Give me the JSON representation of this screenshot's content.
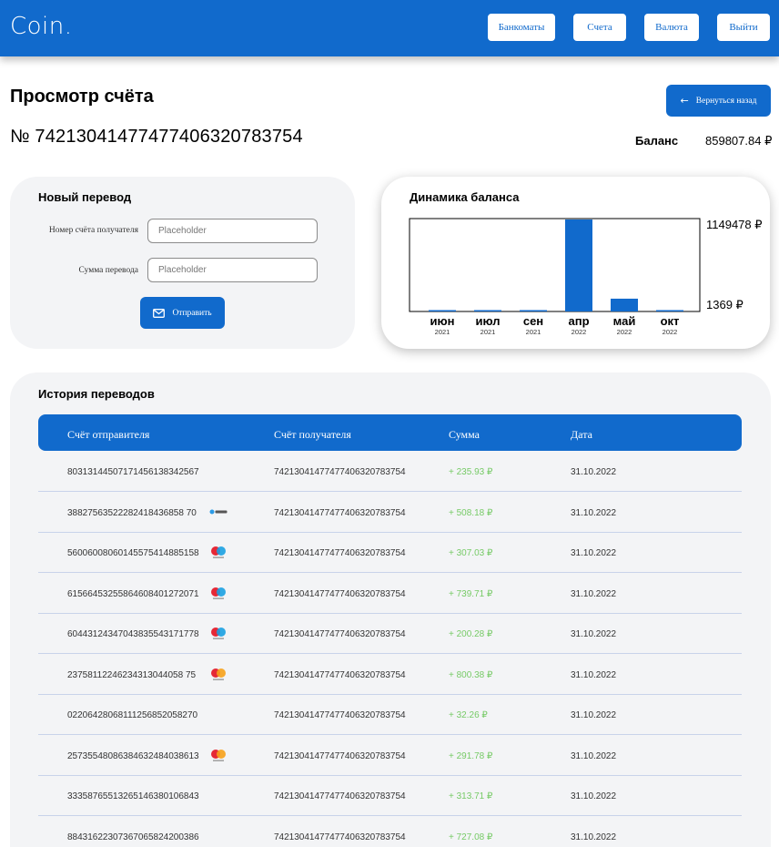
{
  "header": {
    "logo": "Coin.",
    "nav": [
      "Банкоматы",
      "Счета",
      "Валюта",
      "Выйти"
    ]
  },
  "page": {
    "title": "Просмотр счёта",
    "account_number": "№ 74213041477477406320783754",
    "back_label": "Вернуться назад",
    "balance_label": "Баланс",
    "balance_value": "859807.84 ₽"
  },
  "transfer": {
    "title": "Новый перевод",
    "recipient_label": "Номер счёта получателя",
    "recipient_placeholder": "Placeholder",
    "amount_label": "Сумма перевода",
    "amount_placeholder": "Placeholder",
    "send_label": "Отправить"
  },
  "chart_data": {
    "type": "bar",
    "title": "Динамика баланса",
    "categories": [
      "июн",
      "июл",
      "сен",
      "апр",
      "май",
      "окт"
    ],
    "category_years": [
      "2021",
      "2021",
      "2021",
      "2022",
      "2022",
      "2022"
    ],
    "values": [
      14000,
      12000,
      5000,
      1149478,
      160000,
      5000
    ],
    "ylim": [
      0,
      1149478
    ],
    "y_max_label": "1149478 ₽",
    "y_min_label": "1369 ₽",
    "bar_color": "#116acc"
  },
  "history": {
    "title": "История переводов",
    "columns": [
      "Счёт отправителя",
      "Счёт получателя",
      "Сумма",
      "Дата"
    ],
    "rows": [
      {
        "from": "80313144507171456138342567",
        "to": "74213041477477406320783754",
        "amount": "+ 235.93 ₽",
        "date": "31.10.2022",
        "icon": ""
      },
      {
        "from": "38827563522282418436858 70",
        "to": "74213041477477406320783754",
        "amount": "+ 508.18 ₽",
        "date": "31.10.2022",
        "icon": "bank-icon"
      },
      {
        "from": "56006008060145575414885158",
        "to": "74213041477477406320783754",
        "amount": "+ 307.03 ₽",
        "date": "31.10.2022",
        "icon": "maestro-icon"
      },
      {
        "from": "61566453255864608401272071",
        "to": "74213041477477406320783754",
        "amount": "+ 739.71 ₽",
        "date": "31.10.2022",
        "icon": "maestro-icon"
      },
      {
        "from": "60443124347043835543171778",
        "to": "74213041477477406320783754",
        "amount": "+ 200.28 ₽",
        "date": "31.10.2022",
        "icon": "maestro-icon"
      },
      {
        "from": "23758112246234313044058 75",
        "to": "74213041477477406320783754",
        "amount": "+ 800.38 ₽",
        "date": "31.10.2022",
        "icon": "mastercard-icon"
      },
      {
        "from": "02206428068111256852058270",
        "to": "74213041477477406320783754",
        "amount": "+ 32.26 ₽",
        "date": "31.10.2022",
        "icon": ""
      },
      {
        "from": "25735548086384632484038613",
        "to": "74213041477477406320783754",
        "amount": "+ 291.78 ₽",
        "date": "31.10.2022",
        "icon": "mastercard-icon"
      },
      {
        "from": "33358765513265146380106843",
        "to": "74213041477477406320783754",
        "amount": "+ 313.71 ₽",
        "date": "31.10.2022",
        "icon": ""
      },
      {
        "from": "88431622307367065824200386",
        "to": "74213041477477406320783754",
        "amount": "+ 727.08 ₽",
        "date": "31.10.2022",
        "icon": ""
      }
    ]
  }
}
